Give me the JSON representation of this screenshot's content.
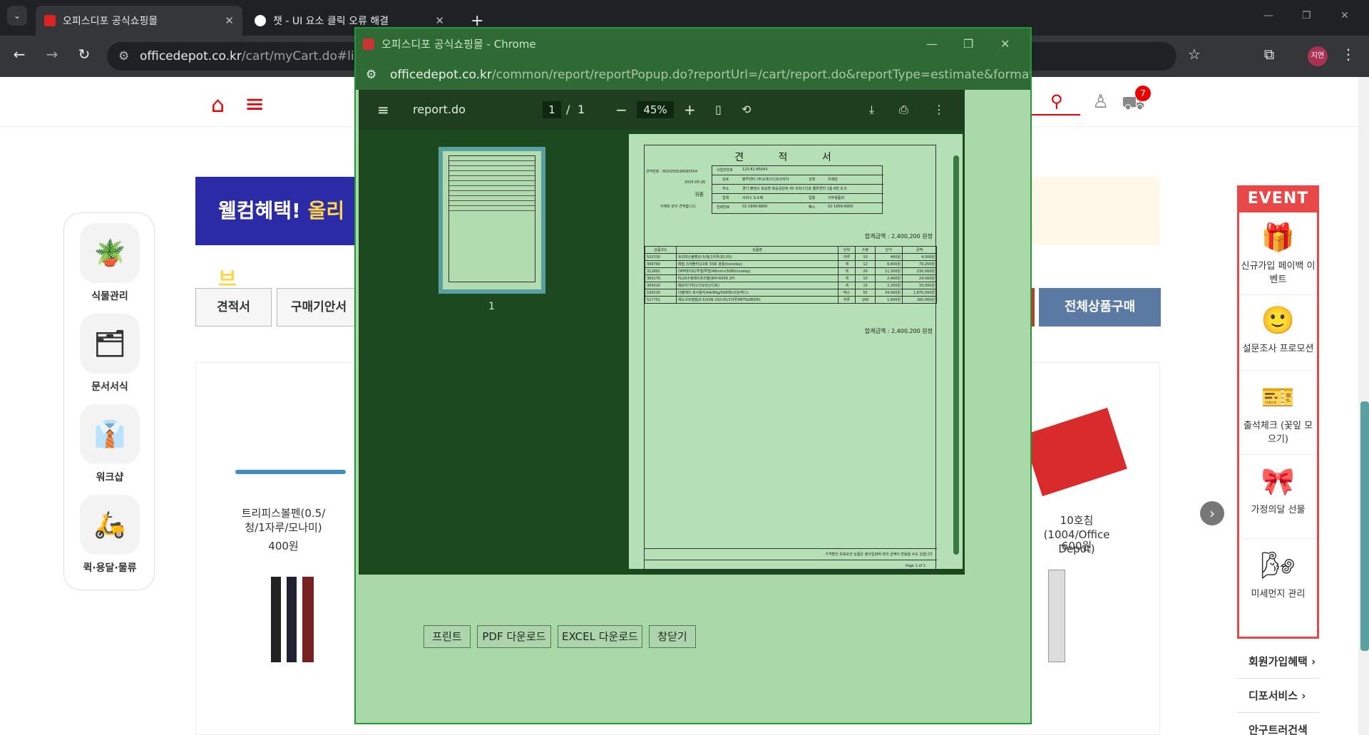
{
  "browser": {
    "tabs": [
      {
        "title": "오피스디포 공식쇼핑몰",
        "close": "✕"
      },
      {
        "title": "챗 - UI 요소 클릭 오류 해결",
        "close": "✕"
      }
    ],
    "new_tab": "+",
    "url_host": "officedepot.co.kr",
    "url_path": "/cart/myCart.do#link",
    "profile": "지연",
    "win_min": "—",
    "win_max": "❐",
    "win_close": "✕"
  },
  "site": {
    "cart_count": "7",
    "sidebar": [
      "식물관리",
      "문서서식",
      "워크샵",
      "퀵·용달·물류"
    ],
    "sidebar_icons": [
      "plant-icon",
      "document-icon",
      "presenter-icon",
      "scooter-icon"
    ],
    "banner_white": "웰컴혜택!",
    "banner_yellow": "올리브",
    "tab_estimate": "견적서",
    "tab_purchase": "구매기안서",
    "buy_all": "전체상품구매",
    "products": [
      {
        "name": "트리피스볼펜(0.5/청/1자루/모나미)",
        "price": "400원"
      },
      {
        "name": "10호침(1004/Office Depot)",
        "price": "600원"
      }
    ],
    "event": {
      "title": "EVENT",
      "items": [
        "신규가입 페이백 이벤트",
        "설문조사 프로모션",
        "출석체크 (꽃잎 모으기)",
        "가정의달 선물",
        "미세먼지 관리"
      ]
    },
    "side_links": [
      "회원가입혜택",
      "디포서비스",
      "안구트러건색"
    ]
  },
  "popup": {
    "window_title": "오피스디포 공식쇼핑몰 - Chrome",
    "url_host": "officedepot.co.kr",
    "url_path": "/common/report/reportPopup.do?reportUrl=/cart/report.do&reportType=estimate&format...",
    "pdf": {
      "filename": "report.do",
      "page_current": "1",
      "page_sep": "/",
      "page_total": "1",
      "zoom": "45%",
      "thumb_label": "1"
    },
    "doc": {
      "title": "견 적 서",
      "estimate_no": "견적번호 : M20250526095504",
      "date": "2025-05-26",
      "to": "귀중",
      "note": "아래와 같이 견적합니다.",
      "supplier": [
        [
          "사업자번호",
          "120-81-85043"
        ],
        [
          "상호",
          "블루센터 (주)오피스디포코리아",
          "성명",
          "유제만"
        ],
        [
          "주소",
          "경기 평택시 포승면 포승공단로 45 오피스디포 물류센터 1층 8번 도크"
        ],
        [
          "업태",
          "서비스 도소매",
          "업종",
          "사무용품외"
        ],
        [
          "전화번호",
          "02-1899-6800",
          "팩스",
          "02-1899-6900"
        ]
      ],
      "total_top": "합계금액 : 2,400,200 원정",
      "headers": [
        "상품코드",
        "상품명",
        "단위",
        "수량",
        "단가",
        "금액"
      ],
      "rows": [
        [
          "520330",
          "트리피스볼펜(0.5/청/1자루/모나미)",
          "자루",
          "10",
          "400원",
          "4,000원"
        ],
        [
          "306760",
          "매밀 스테플러(10호 33호 겸용/Iniceday)",
          "개",
          "12",
          "6,600원",
          "79,200원"
        ],
        [
          "312891",
          "OPP테이프(투명/투명/48mm×50M/niceday)",
          "개",
          "20",
          "11,500원",
          "230,000원"
        ],
        [
          "300170",
          "PLUS수정테이프리필(WH-605R 2P)",
          "개",
          "10",
          "2,400원",
          "24,000원"
        ],
        [
          "305010",
          "메모지가위(17/오피스디포)",
          "개",
          "15",
          "2,200원",
          "33,000원"
        ],
        [
          "100220",
          "더블에이 복사용지(A4/80g/500매×5권/박스)",
          "박스",
          "55",
          "34,000원",
          "1,870,000원"
        ],
        [
          "517751",
          "제도샤프펜슬(0.5/SXN-150-05/1자루/MITSUBISHI)",
          "자루",
          "100",
          "1,600원",
          "160,000원"
        ]
      ],
      "total_bottom": "합계금액 : 2,400,200 원정",
      "footer_note": "가격할인 프로모션 상품은 행사일정에 따라 금액이 변동될 수도 있습니다",
      "page_label": "Page 1 of 1"
    },
    "buttons": [
      "프린트",
      "PDF 다운로드",
      "EXCEL 다운로드",
      "창닫기"
    ]
  }
}
